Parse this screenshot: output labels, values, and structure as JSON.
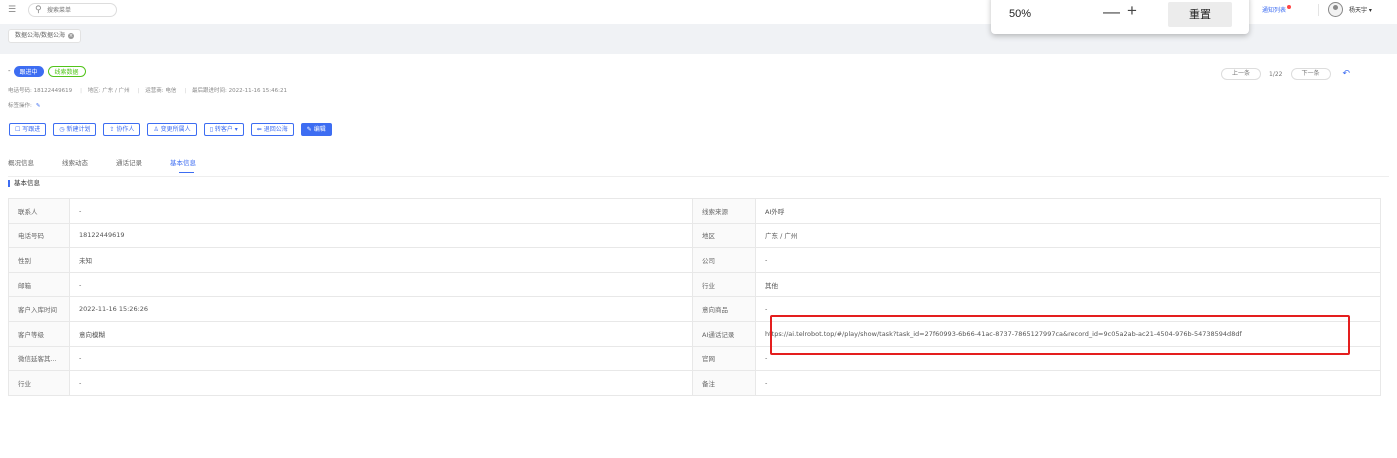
{
  "search": {
    "placeholder": "搜索菜单"
  },
  "header_right": {
    "notify_label": "通知列表",
    "user_name": "杨天宇 ▾"
  },
  "zoom_popup": {
    "value": "50%",
    "minus": "—",
    "plus": "+",
    "reset_label": "重置"
  },
  "page_tab": {
    "label": "数据公海/数据公海",
    "close": "×"
  },
  "record": {
    "dash": "-",
    "status_badge": "跟进中",
    "source_badge": "线索数据",
    "meta": [
      "电话号码: 18122449619",
      "地区: 广东 / 广州",
      "运营商: 电信",
      "最后跟进时间: 2022-11-16 15:46:21"
    ],
    "tag_label": "标签操作:",
    "tag_edit": "✎"
  },
  "nav": {
    "prev": "上一条",
    "count": "1/22",
    "next": "下一条",
    "back_icon": "↶"
  },
  "actions": [
    "☐ 写跟进",
    "◷ 新建计划",
    "⇪ 协作人",
    "♙ 变更所属人",
    "▯ 转客户 ▾",
    "⇚ 退回公海",
    "✎ 编辑"
  ],
  "detail_tabs": [
    "概况信息",
    "线索动态",
    "通话记录",
    "基本信息"
  ],
  "section_title": "基本信息",
  "table": [
    [
      "联系人",
      "-",
      "线索来源",
      "AI外呼"
    ],
    [
      "电话号码",
      "18122449619",
      "地区",
      "广东 / 广州"
    ],
    [
      "性别",
      "未知",
      "公司",
      "-"
    ],
    [
      "邮箱",
      "-",
      "行业",
      "其他"
    ],
    [
      "客户入库时间",
      "2022-11-16 15:26:26",
      "意向商品",
      "-"
    ],
    [
      "客户等级",
      "意向模糊",
      "AI通话记录",
      "https://ai.telrobot.top/#/play/show/task?task_id=27f60993-6b66-41ac-8737-7865127997ca&record_id=9c05a2ab-ac21-4504-976b-54738594d8df"
    ],
    [
      "微信延客其...",
      "-",
      "官网",
      "-"
    ],
    [
      "行业",
      "-",
      "备注",
      "-"
    ]
  ],
  "colors": {
    "accent": "#3d6df2",
    "highlight": "#e41e1e",
    "success": "#52c41a"
  },
  "icons": [
    "menu-icon",
    "search-icon",
    "bell-icon",
    "avatar-icon",
    "close-icon",
    "back-icon",
    "edit-icon"
  ]
}
